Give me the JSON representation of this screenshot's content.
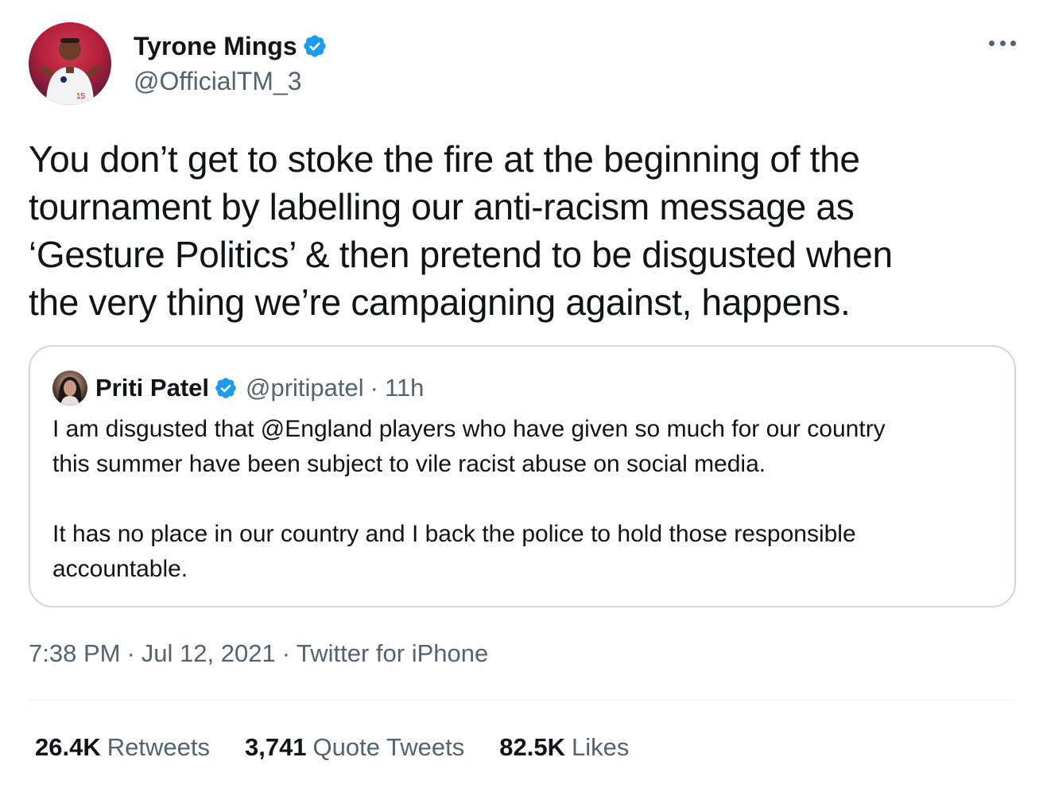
{
  "author": {
    "name": "Tyrone Mings",
    "handle": "@OfficialTM_3",
    "verified": true
  },
  "tweet": {
    "lines": [
      "You don’t get to stoke the fire at the beginning of the",
      "tournament by labelling our anti-racism message as",
      "‘Gesture Politics’ & then pretend to be disgusted when",
      "the very thing we’re campaigning against, happens."
    ]
  },
  "quote": {
    "name": "Priti Patel",
    "handle": "@pritipatel",
    "separator": "·",
    "time": "11h",
    "verified": true,
    "paragraph1": [
      "I am disgusted that @England players who have given so much for our country",
      "this summer have been subject to vile racist abuse on social media."
    ],
    "paragraph2": [
      "It has no place in our country and I back the police to hold those responsible",
      "accountable."
    ]
  },
  "meta": {
    "time": "7:38 PM",
    "date": "Jul 12, 2021",
    "source": "Twitter for iPhone",
    "separator": "·"
  },
  "stats": {
    "retweets_count": "26.4K",
    "retweets_label": "Retweets",
    "quotes_count": "3,741",
    "quotes_label": "Quote Tweets",
    "likes_count": "82.5K",
    "likes_label": "Likes"
  },
  "colors": {
    "verified_blue": "#1d9bf0",
    "secondary_text": "#536471",
    "primary_text": "#0f1419",
    "border": "#cfd9de"
  },
  "icons": {
    "verified": "verified-badge-icon",
    "more": "more-options-icon"
  }
}
